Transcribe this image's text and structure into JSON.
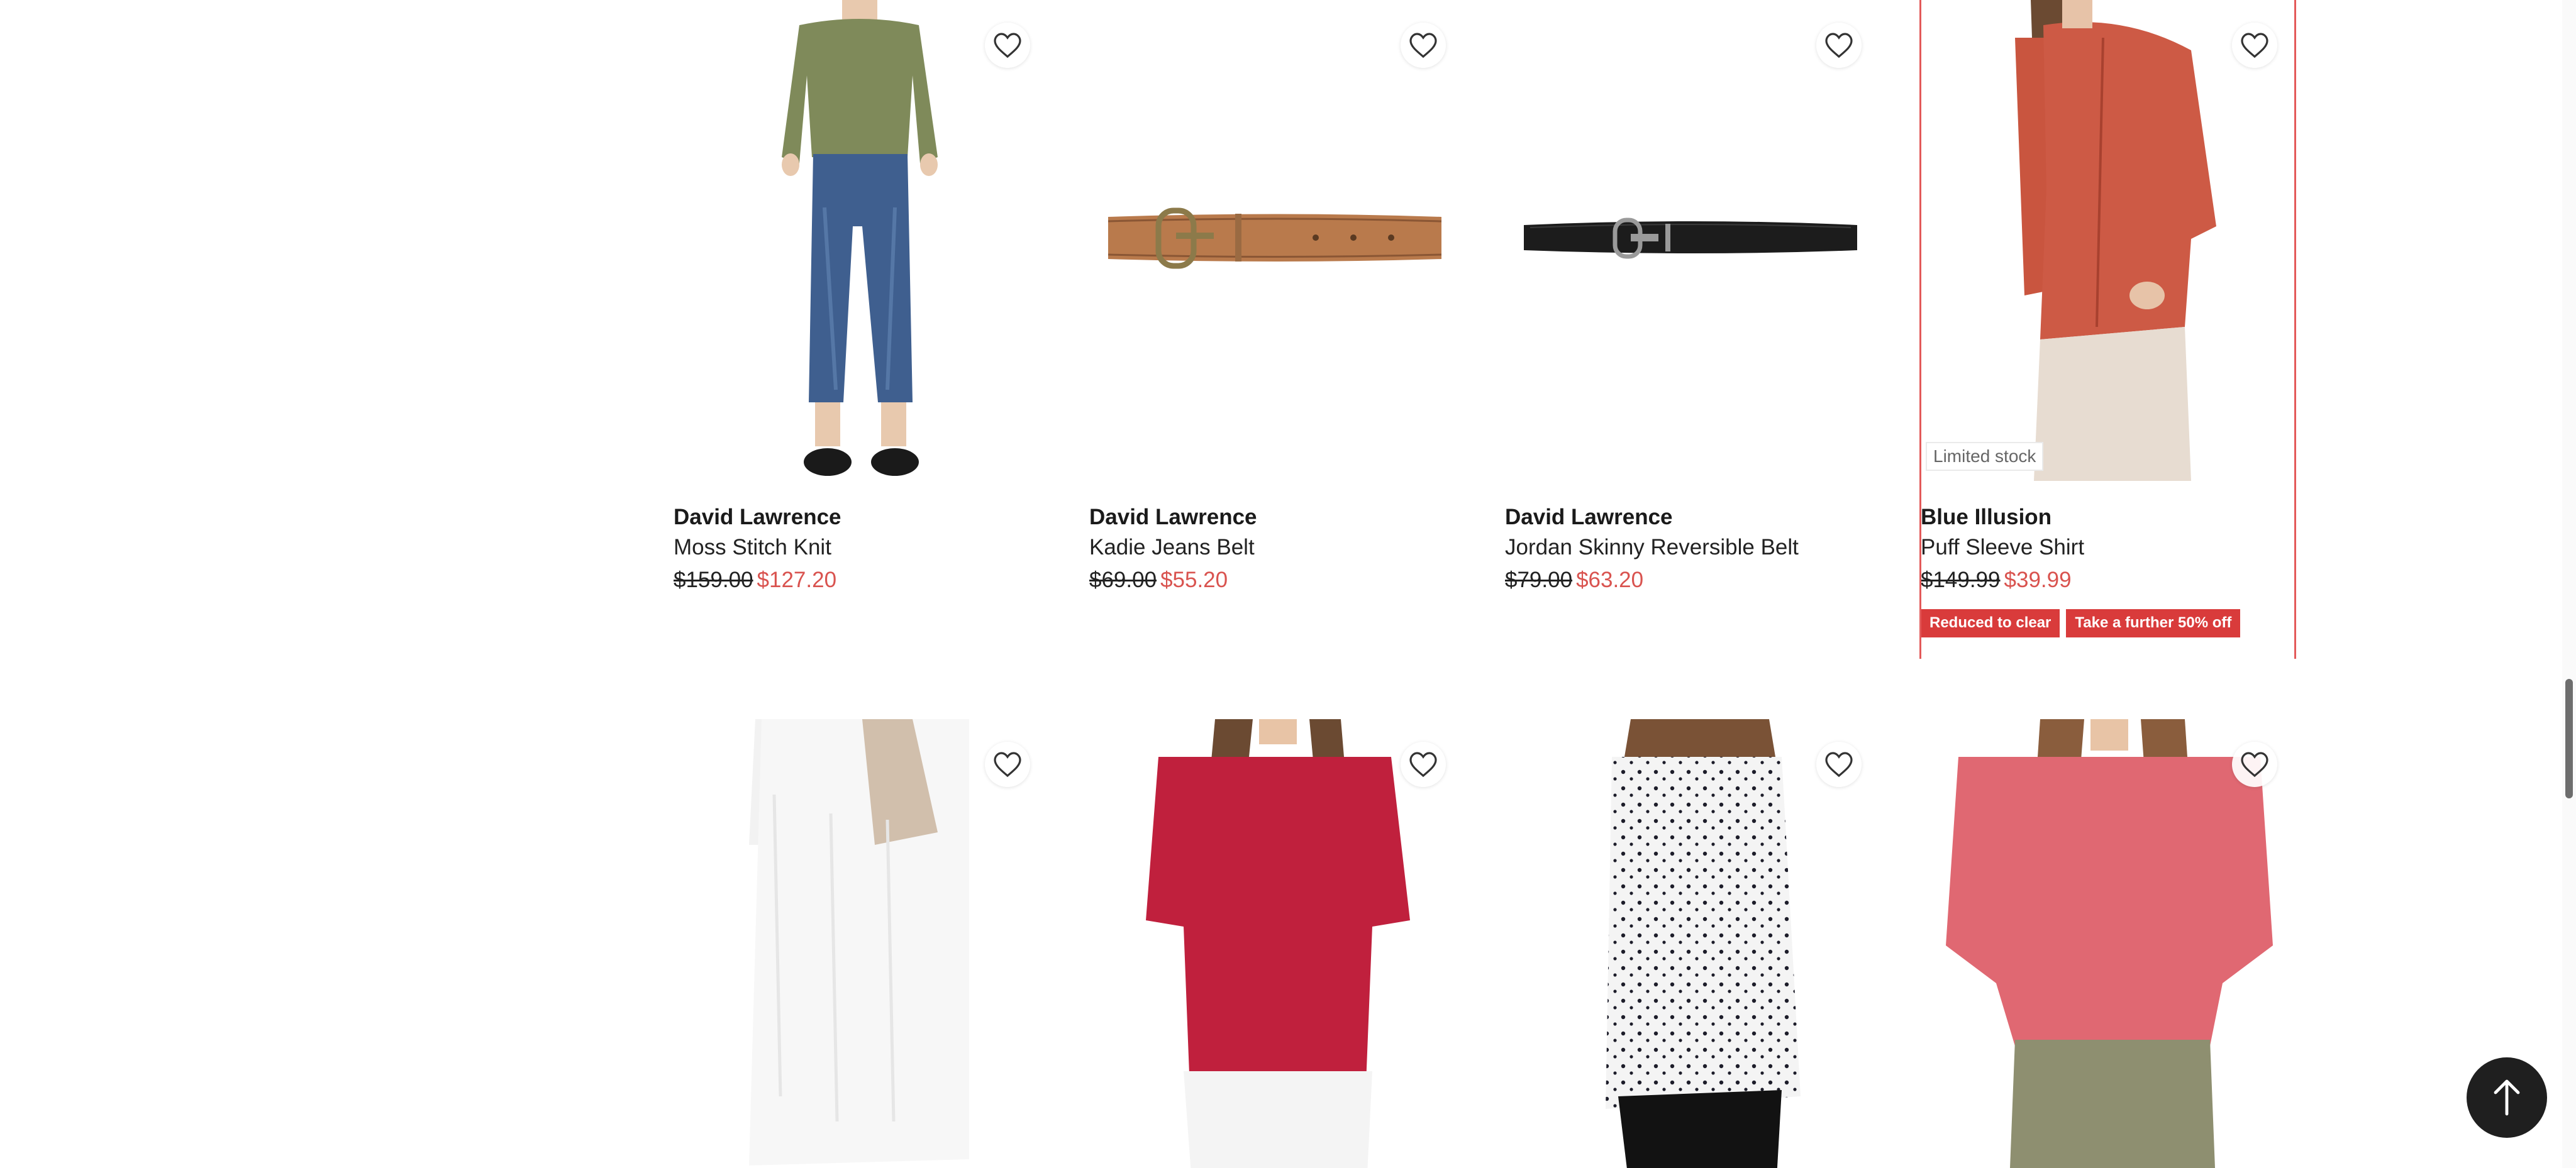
{
  "colors": {
    "sale_price": "#d9534f",
    "badge_bg": "#d93b3b",
    "highlight_border": "#e35a5a",
    "back_to_top_bg": "#1f1f1f"
  },
  "products_row1": [
    {
      "brand": "David Lawrence",
      "name": "Moss Stitch Knit",
      "was_price": "$159.00",
      "now_price": "$127.20",
      "image": "model-in-knit-sweater-and-jeans",
      "favorite_icon": "heart-outline-icon"
    },
    {
      "brand": "David Lawrence",
      "name": "Kadie Jeans Belt",
      "was_price": "$69.00",
      "now_price": "$55.20",
      "image": "tan-leather-belt",
      "favorite_icon": "heart-outline-icon"
    },
    {
      "brand": "David Lawrence",
      "name": "Jordan Skinny Reversible Belt",
      "was_price": "$79.00",
      "now_price": "$63.20",
      "image": "black-skinny-belt",
      "favorite_icon": "heart-outline-icon"
    },
    {
      "brand": "Blue Illusion",
      "name": "Puff Sleeve Shirt",
      "was_price": "$149.99",
      "now_price": "$39.99",
      "stock_label": "Limited stock",
      "badges": [
        "Reduced to clear",
        "Take a further 50% off"
      ],
      "image": "model-in-red-shirt",
      "favorite_icon": "heart-outline-icon"
    }
  ],
  "products_row2": [
    {
      "image": "model-in-white-blouse",
      "favorite_icon": "heart-outline-icon"
    },
    {
      "image": "model-in-red-tee",
      "favorite_icon": "heart-outline-icon"
    },
    {
      "image": "model-in-spot-print-blouse",
      "favorite_icon": "heart-outline-icon"
    },
    {
      "image": "model-in-pink-top",
      "favorite_icon": "heart-outline-icon"
    }
  ],
  "back_to_top_icon": "arrow-up-icon"
}
